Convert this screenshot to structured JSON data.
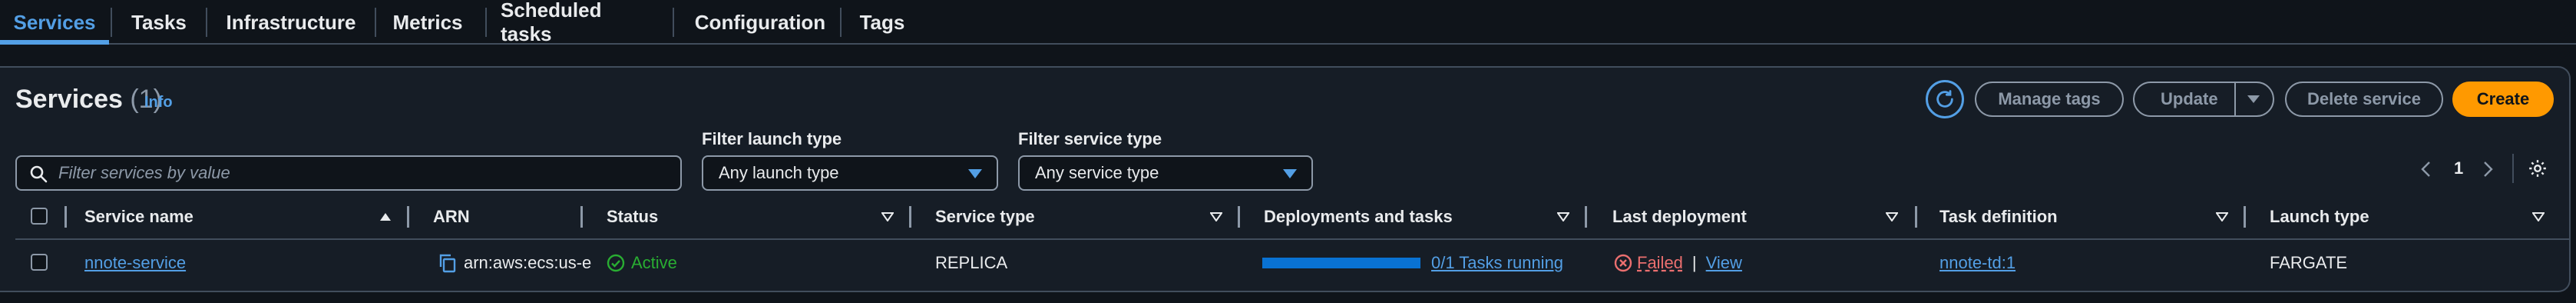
{
  "tabs": [
    {
      "label": "Services",
      "active": true
    },
    {
      "label": "Tasks"
    },
    {
      "label": "Infrastructure"
    },
    {
      "label": "Metrics"
    },
    {
      "label": "Scheduled tasks"
    },
    {
      "label": "Configuration"
    },
    {
      "label": "Tags"
    }
  ],
  "header": {
    "title": "Services",
    "count": "(1)",
    "info": "Info",
    "buttons": {
      "manage_tags": "Manage tags",
      "update": "Update",
      "delete": "Delete service",
      "create": "Create"
    }
  },
  "filters": {
    "search_placeholder": "Filter services by value",
    "launch_type_label": "Filter launch type",
    "launch_type_value": "Any launch type",
    "service_type_label": "Filter service type",
    "service_type_value": "Any service type"
  },
  "pagination": {
    "page": "1"
  },
  "table": {
    "columns": [
      "Service name",
      "ARN",
      "Status",
      "Service type",
      "Deployments and tasks",
      "Last deployment",
      "Task definition",
      "Launch type"
    ],
    "rows": [
      {
        "service_name": "nnote-service",
        "arn": "arn:aws:ecs:us-e",
        "status": "Active",
        "service_type": "REPLICA",
        "tasks": "0/1 Tasks running",
        "tasks_progress": 0,
        "last_deployment": "Failed",
        "view": "View",
        "deploy_sep": "|",
        "task_definition": "nnote-td:1",
        "launch_type": "FARGATE"
      }
    ]
  },
  "colors": {
    "accent": "#539fe5",
    "primary": "#ff9900",
    "success": "#29ad32",
    "error": "#eb6f6f",
    "progress": "#0972d3"
  },
  "icons": [
    "refresh-icon",
    "caret-down-icon",
    "search-icon",
    "chevron-left-icon",
    "chevron-right-icon",
    "gear-icon",
    "sort-ascending-icon",
    "sort-icon",
    "copy-icon",
    "status-success-icon",
    "status-error-icon"
  ]
}
